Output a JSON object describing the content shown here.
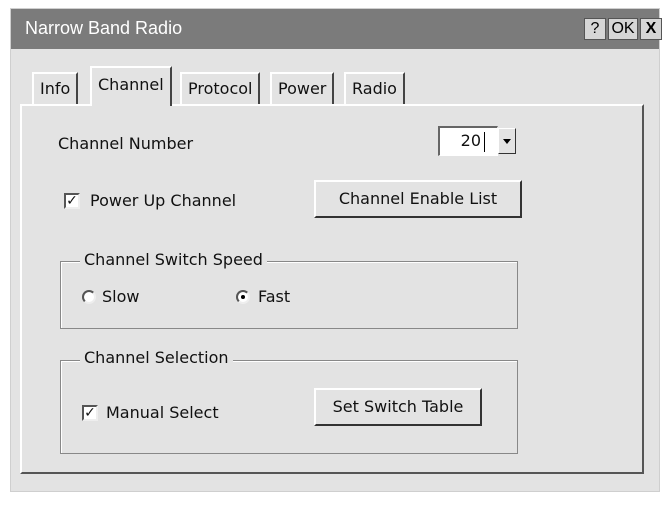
{
  "window": {
    "title": "Narrow Band Radio",
    "help_label": "?",
    "ok_label": "OK",
    "close_label": "X"
  },
  "tabs": [
    {
      "label": "Info",
      "active": false
    },
    {
      "label": "Channel",
      "active": true
    },
    {
      "label": "Protocol",
      "active": false
    },
    {
      "label": "Power",
      "active": false
    },
    {
      "label": "Radio",
      "active": false
    }
  ],
  "channel": {
    "number_label": "Channel Number",
    "number_value": "20",
    "power_up_label": "Power Up Channel",
    "power_up_checked": true,
    "enable_list_button": "Channel Enable List"
  },
  "switch_speed": {
    "title": "Channel Switch Speed",
    "options": [
      {
        "label": "Slow",
        "selected": false
      },
      {
        "label": "Fast",
        "selected": true
      }
    ]
  },
  "selection": {
    "title": "Channel Selection",
    "manual_label": "Manual Select",
    "manual_checked": true,
    "switch_table_button": "Set Switch Table"
  },
  "colors": {
    "titlebar": "#7b7b7b",
    "dialog_bg": "#e3e3e3"
  }
}
